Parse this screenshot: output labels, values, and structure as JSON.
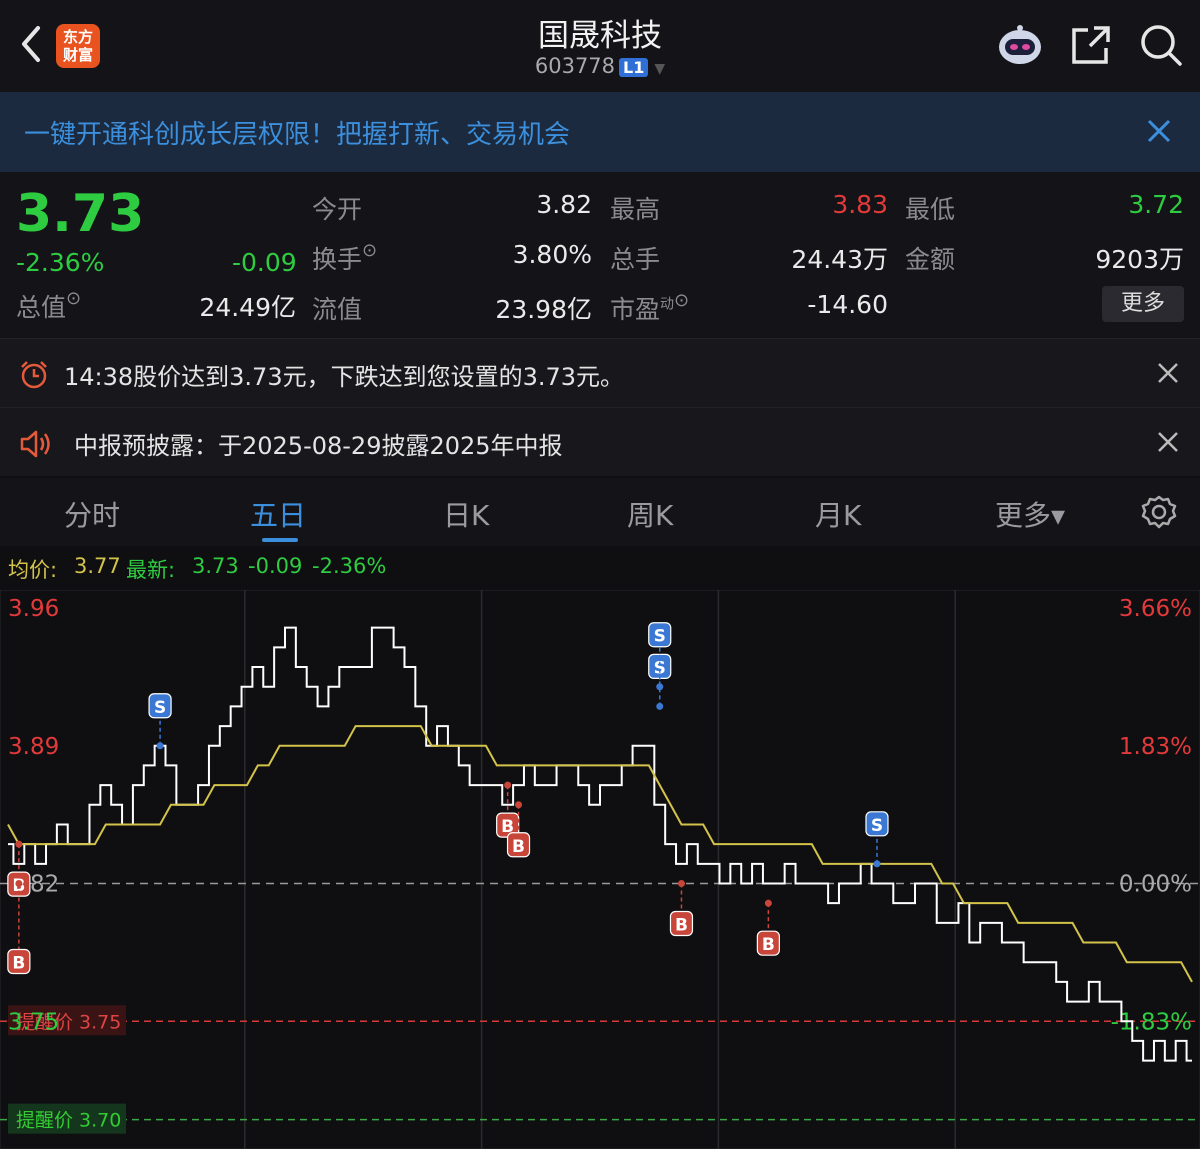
{
  "header": {
    "logo_line1": "东方",
    "logo_line2": "财富",
    "title": "国晟科技",
    "code": "603778",
    "level_badge": "L1",
    "icons": [
      "back-arrow-icon",
      "robot-icon",
      "share-icon",
      "search-icon"
    ]
  },
  "banner": {
    "text": "一键开通科创成长层权限！把握打新、交易机会"
  },
  "quote": {
    "price": "3.73",
    "pct": "-2.36%",
    "change": "-0.09",
    "total_value_label": "总值",
    "total_value": "24.49亿",
    "rows": [
      [
        {
          "label": "今开",
          "value": "3.82",
          "color": "#eaeaea"
        },
        {
          "label": "最高",
          "value": "3.83",
          "color": "#e23a3a"
        },
        {
          "label": "最低",
          "value": "3.72",
          "color": "#2ecc40"
        }
      ],
      [
        {
          "label": "换手",
          "value": "3.80%",
          "color": "#eaeaea"
        },
        {
          "label": "总手",
          "value": "24.43万",
          "color": "#eaeaea"
        },
        {
          "label": "金额",
          "value": "9203万",
          "color": "#eaeaea"
        }
      ],
      [
        {
          "label": "流值",
          "value": "23.98亿",
          "color": "#eaeaea"
        },
        {
          "label": "市盈",
          "value": "-14.60",
          "color": "#eaeaea"
        }
      ]
    ],
    "pe_sup": "动",
    "more_label": "更多"
  },
  "alerts": [
    {
      "text": "14:38股价达到3.73元，下跌达到您设置的3.73元。",
      "icon": "alarm-clock-icon"
    },
    {
      "text": "中报预披露：于2025-08-29披露2025年中报",
      "icon": "speaker-icon"
    }
  ],
  "tabs": [
    {
      "label": "分时"
    },
    {
      "label": "五日"
    },
    {
      "label": "日K"
    },
    {
      "label": "周K"
    },
    {
      "label": "月K"
    },
    {
      "label": "更多▾"
    }
  ],
  "active_tab": "五日",
  "legend": {
    "avg_label": "均价:",
    "avg_value": "3.77",
    "latest_label": "最新:",
    "latest_value": "3.73",
    "change": "-0.09",
    "pct": "-2.36%"
  },
  "colors": {
    "up": "#e23a3a",
    "down": "#2ecc40",
    "accent": "#3c8fdc",
    "avg_line": "#d4c34a",
    "price_line": "#ffffff",
    "buy_marker": "#c8453a",
    "sell_marker": "#3a78d4"
  },
  "chart_data": {
    "type": "line",
    "series": [
      {
        "name": "最新",
        "values": [
          3.84,
          3.83,
          3.84,
          3.83,
          3.84,
          3.85,
          3.84,
          3.84,
          3.86,
          3.87,
          3.86,
          3.85,
          3.87,
          3.88,
          3.89,
          3.88,
          3.86,
          3.86,
          3.87,
          3.89,
          3.9,
          3.91,
          3.92,
          3.93,
          3.92,
          3.94,
          3.95,
          3.93,
          3.92,
          3.91,
          3.92,
          3.93,
          3.93,
          3.93,
          3.95,
          3.95,
          3.94,
          3.93,
          3.91,
          3.89,
          3.9,
          3.89,
          3.88,
          3.87,
          3.87,
          3.87,
          3.86,
          3.87,
          3.88,
          3.87,
          3.87,
          3.88,
          3.88,
          3.87,
          3.86,
          3.87,
          3.87,
          3.88,
          3.89,
          3.89,
          3.86,
          3.84,
          3.83,
          3.84,
          3.83,
          3.83,
          3.82,
          3.83,
          3.82,
          3.83,
          3.82,
          3.82,
          3.83,
          3.82,
          3.82,
          3.82,
          3.81,
          3.82,
          3.82,
          3.83,
          3.82,
          3.82,
          3.81,
          3.81,
          3.82,
          3.82,
          3.8,
          3.8,
          3.81,
          3.79,
          3.8,
          3.8,
          3.79,
          3.79,
          3.78,
          3.78,
          3.78,
          3.77,
          3.76,
          3.76,
          3.77,
          3.76,
          3.76,
          3.75,
          3.74,
          3.73,
          3.74,
          3.73,
          3.74,
          3.73
        ]
      },
      {
        "name": "均价",
        "values": [
          3.85,
          3.84,
          3.84,
          3.84,
          3.84,
          3.84,
          3.84,
          3.84,
          3.84,
          3.85,
          3.85,
          3.85,
          3.85,
          3.85,
          3.85,
          3.86,
          3.86,
          3.86,
          3.86,
          3.87,
          3.87,
          3.87,
          3.87,
          3.88,
          3.88,
          3.89,
          3.89,
          3.89,
          3.89,
          3.89,
          3.89,
          3.89,
          3.9,
          3.9,
          3.9,
          3.9,
          3.9,
          3.9,
          3.9,
          3.89,
          3.89,
          3.89,
          3.89,
          3.89,
          3.89,
          3.88,
          3.88,
          3.88,
          3.88,
          3.88,
          3.88,
          3.88,
          3.88,
          3.88,
          3.88,
          3.88,
          3.88,
          3.88,
          3.88,
          3.88,
          3.87,
          3.86,
          3.85,
          3.85,
          3.85,
          3.84,
          3.84,
          3.84,
          3.84,
          3.84,
          3.84,
          3.84,
          3.84,
          3.84,
          3.84,
          3.83,
          3.83,
          3.83,
          3.83,
          3.83,
          3.83,
          3.83,
          3.83,
          3.83,
          3.83,
          3.83,
          3.82,
          3.82,
          3.81,
          3.81,
          3.81,
          3.81,
          3.81,
          3.8,
          3.8,
          3.8,
          3.8,
          3.8,
          3.8,
          3.79,
          3.79,
          3.79,
          3.79,
          3.78,
          3.78,
          3.78,
          3.78,
          3.78,
          3.78,
          3.77
        ]
      }
    ],
    "prev_close": 3.82,
    "ylim": [
      3.68,
      3.96
    ],
    "y_ticks_left": [
      "3.96",
      "3.89",
      "3.82",
      "3.75"
    ],
    "y_ticks_right": [
      "3.66%",
      "1.83%",
      "0.00%",
      "-1.83%"
    ],
    "alert_lines": [
      {
        "label": "提醒价 3.75",
        "value": 3.75
      },
      {
        "label": "提醒价 3.70",
        "value": 3.7
      }
    ],
    "markers": [
      {
        "type": "B",
        "index": 1,
        "value": 3.84
      },
      {
        "type": "B",
        "index": 1,
        "value": 3.82
      },
      {
        "type": "S",
        "index": 14,
        "value": 3.89
      },
      {
        "type": "B",
        "index": 46,
        "value": 3.87
      },
      {
        "type": "B",
        "index": 47,
        "value": 3.86
      },
      {
        "type": "S",
        "index": 60,
        "value": 3.91
      },
      {
        "type": "S",
        "index": 60,
        "value": 3.92
      },
      {
        "type": "B",
        "index": 62,
        "value": 3.82
      },
      {
        "type": "B",
        "index": 70,
        "value": 3.81
      },
      {
        "type": "S",
        "index": 80,
        "value": 3.83
      }
    ],
    "day_dividers": 4
  }
}
